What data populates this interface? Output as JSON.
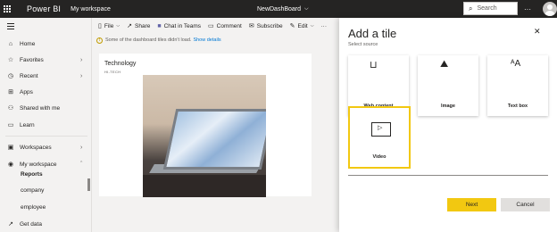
{
  "header": {
    "app_name": "Power BI",
    "workspace": "My workspace",
    "dashboard_name": "NewDashBoard",
    "search_placeholder": "Search",
    "more": "···"
  },
  "sidebar": {
    "items": [
      {
        "label": "Home",
        "icon": "home-icon"
      },
      {
        "label": "Favorites",
        "icon": "star-icon"
      },
      {
        "label": "Recent",
        "icon": "clock-icon"
      },
      {
        "label": "Apps",
        "icon": "apps-icon"
      },
      {
        "label": "Shared with me",
        "icon": "person-icon"
      },
      {
        "label": "Learn",
        "icon": "book-icon"
      },
      {
        "label": "Workspaces",
        "icon": "workspaces-icon"
      },
      {
        "label": "My workspace",
        "icon": "user-icon"
      }
    ],
    "sub_items": [
      "Reports",
      "company",
      "employee"
    ],
    "get_data": "Get data"
  },
  "toolbar": {
    "file": "File",
    "share": "Share",
    "chat": "Chat in Teams",
    "comment": "Comment",
    "subscribe": "Subscribe",
    "edit": "Edit",
    "more": "···"
  },
  "warning": {
    "text": "Some of the dashboard tiles didn't load.",
    "link": "Show details"
  },
  "tile": {
    "title": "Technology",
    "subtitle": "HI-TECH"
  },
  "panel": {
    "title": "Add a tile",
    "subtitle": "Select source",
    "options": [
      {
        "label": "Web content",
        "icon": "web-content-icon"
      },
      {
        "label": "Image",
        "icon": "image-icon"
      },
      {
        "label": "Text box",
        "icon": "text-box-icon"
      },
      {
        "label": "Video",
        "icon": "video-icon"
      }
    ],
    "next": "Next",
    "cancel": "Cancel",
    "close": "✕"
  },
  "colors": {
    "header_bg": "#252423",
    "accent": "#f2c811",
    "link": "#0078d4"
  }
}
